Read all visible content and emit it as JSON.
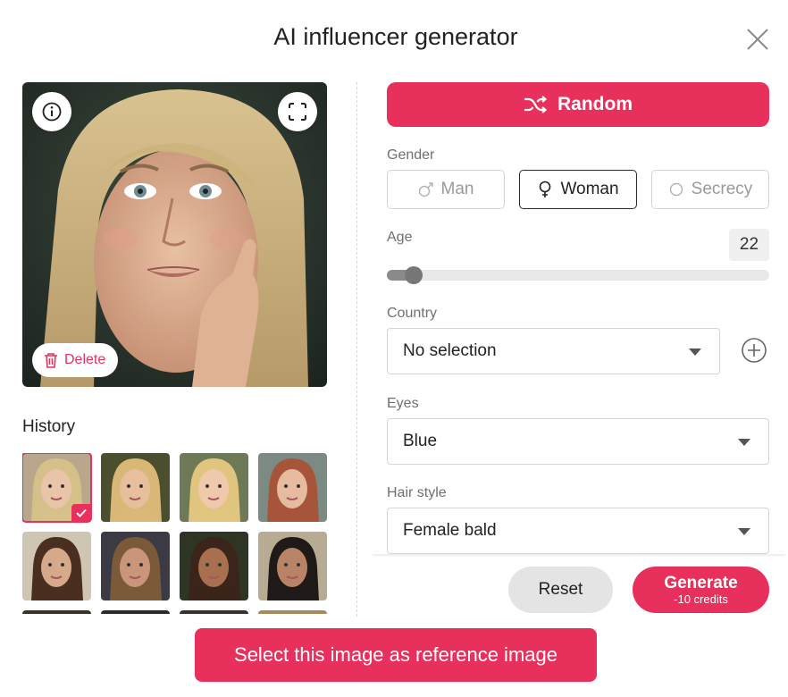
{
  "dialog": {
    "title": "AI influencer generator"
  },
  "preview": {
    "delete_label": "Delete"
  },
  "history": {
    "label": "History",
    "thumbs": [
      {
        "bg": "#b9a68c",
        "hair": "#d6c08a",
        "skin": "#e8c4a8",
        "selected": true
      },
      {
        "bg": "#4b4f2e",
        "hair": "#d9b877",
        "skin": "#e7bf9d",
        "selected": false
      },
      {
        "bg": "#6e7a55",
        "hair": "#e0c57f",
        "skin": "#f0c9ac",
        "selected": false
      },
      {
        "bg": "#7b8b84",
        "hair": "#a6553b",
        "skin": "#e7bba0",
        "selected": false
      },
      {
        "bg": "#cfc5b3",
        "hair": "#4a2e1f",
        "skin": "#d6a98a",
        "selected": false
      },
      {
        "bg": "#3c3a44",
        "hair": "#7b5a3a",
        "skin": "#c99679",
        "selected": false
      },
      {
        "bg": "#2f3524",
        "hair": "#3b2419",
        "skin": "#a8704e",
        "selected": false
      },
      {
        "bg": "#b8ab93",
        "hair": "#1f1a18",
        "skin": "#b98367",
        "selected": false
      },
      {
        "bg": "#3a3226",
        "hair": "#5a4028",
        "skin": "#c9a080",
        "selected": false
      },
      {
        "bg": "#2e2a27",
        "hair": "#3a2a20",
        "skin": "#b8876a",
        "selected": false
      },
      {
        "bg": "#38302a",
        "hair": "#4a3224",
        "skin": "#c49172",
        "selected": false
      },
      {
        "bg": "#a88a5a",
        "hair": "#6a4a2e",
        "skin": "#d3a683",
        "selected": false
      }
    ]
  },
  "form": {
    "random_label": "Random",
    "gender": {
      "label": "Gender",
      "options": [
        "Man",
        "Woman",
        "Secrecy"
      ],
      "selected": "Woman"
    },
    "age": {
      "label": "Age",
      "value": "22",
      "slider_fraction": 0.07
    },
    "country": {
      "label": "Country",
      "value": "No selection"
    },
    "eyes": {
      "label": "Eyes",
      "value": "Blue"
    },
    "hair_style": {
      "label": "Hair style",
      "value": "Female bald"
    }
  },
  "actions": {
    "reset_label": "Reset",
    "generate_label": "Generate",
    "generate_cost": "-10 credits",
    "reference_label": "Select this image as reference image"
  },
  "colors": {
    "accent": "#e8305c"
  }
}
